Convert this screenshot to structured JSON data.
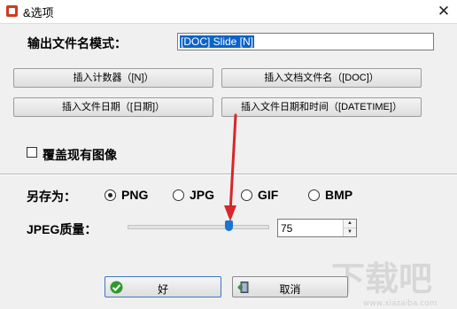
{
  "window": {
    "title": "&选项",
    "close_glyph": "✕"
  },
  "output": {
    "label": "输出文件名模式：",
    "value": "[DOC] Slide [N]"
  },
  "insert_buttons": [
    "插入计数器（[N]）",
    "插入文档文件名（[DOC]）",
    "插入文件日期（[日期]）",
    "插入文件日期和时间（[DATETIME]）"
  ],
  "overwrite": {
    "label": "覆盖现有图像",
    "checked": false
  },
  "save_as": {
    "label": "另存为：",
    "options": [
      "PNG",
      "JPG",
      "GIF",
      "BMP"
    ],
    "selected": "PNG"
  },
  "jpeg": {
    "label": "JPEG质量：",
    "value": "75",
    "slider_fraction": 0.73
  },
  "buttons": {
    "ok": "好",
    "cancel": "取消"
  },
  "watermark": {
    "text": "下载吧",
    "url": "www.xiazaiba.com"
  },
  "colors": {
    "selection": "#0a64c8",
    "arrow": "#d8262b",
    "slider_thumb": "#1a74d2"
  }
}
